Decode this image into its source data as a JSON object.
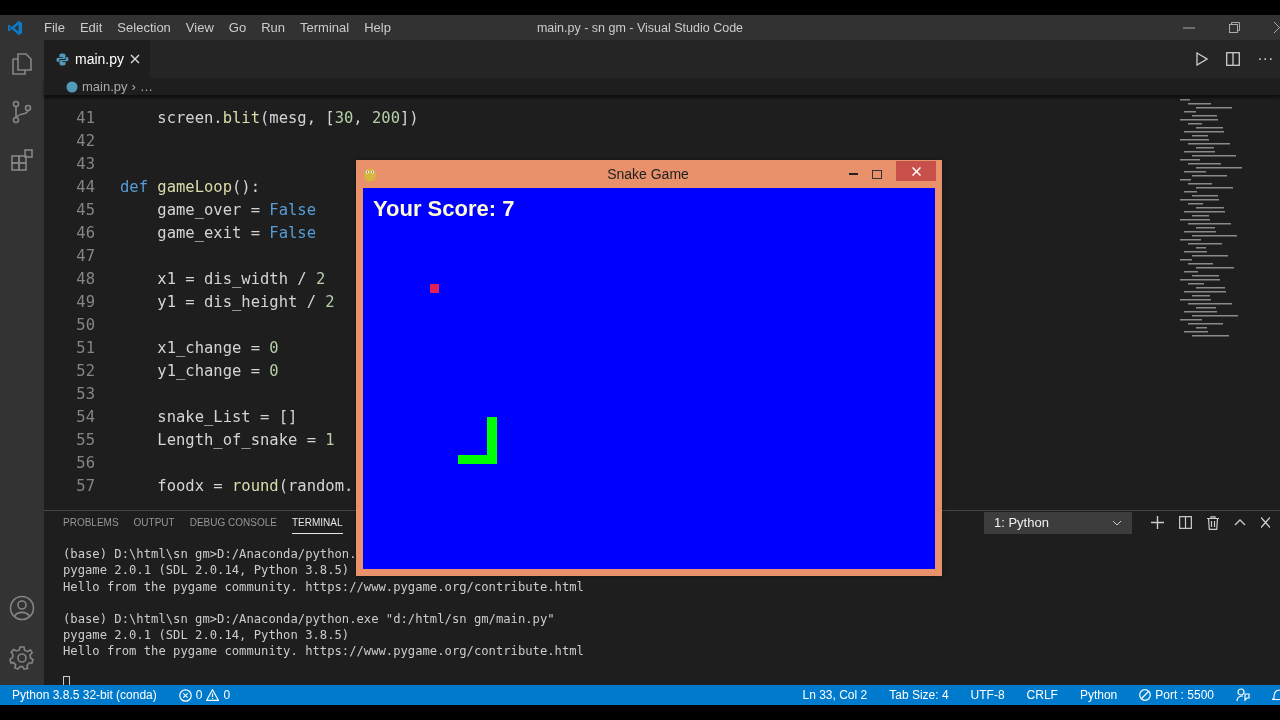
{
  "window": {
    "title": "main.py - sn gm - Visual Studio Code"
  },
  "menu": [
    "File",
    "Edit",
    "Selection",
    "View",
    "Go",
    "Run",
    "Terminal",
    "Help"
  ],
  "tabs": [
    {
      "label": "main.py",
      "selected": true
    }
  ],
  "breadcrumb": {
    "file": "main.py",
    "separator": "›",
    "more": "…"
  },
  "editor_actions": {
    "more": "···"
  },
  "code_lines": [
    {
      "number": "41",
      "tokens": [
        {
          "text": "    screen.",
          "kind": "plain"
        },
        {
          "text": "blit",
          "kind": "function"
        },
        {
          "text": "(mesg, [",
          "kind": "plain"
        },
        {
          "text": "30",
          "kind": "number"
        },
        {
          "text": ", ",
          "kind": "plain"
        },
        {
          "text": "200",
          "kind": "number"
        },
        {
          "text": "])",
          "kind": "plain"
        }
      ]
    },
    {
      "number": "42"
    },
    {
      "number": "43"
    },
    {
      "number": "44",
      "tokens": [
        {
          "text": "def ",
          "kind": "keyword"
        },
        {
          "text": "gameLoop",
          "kind": "function"
        },
        {
          "text": "():",
          "kind": "plain"
        }
      ]
    },
    {
      "number": "45",
      "tokens": [
        {
          "text": "    game_over = ",
          "kind": "plain"
        },
        {
          "text": "False",
          "kind": "keyword"
        }
      ]
    },
    {
      "number": "46",
      "tokens": [
        {
          "text": "    game_exit = ",
          "kind": "plain"
        },
        {
          "text": "False",
          "kind": "keyword"
        }
      ]
    },
    {
      "number": "47"
    },
    {
      "number": "48",
      "tokens": [
        {
          "text": "    x1 = dis_width / ",
          "kind": "plain"
        },
        {
          "text": "2",
          "kind": "number"
        }
      ]
    },
    {
      "number": "49",
      "tokens": [
        {
          "text": "    y1 = dis_height / ",
          "kind": "plain"
        },
        {
          "text": "2",
          "kind": "number"
        }
      ]
    },
    {
      "number": "50"
    },
    {
      "number": "51",
      "tokens": [
        {
          "text": "    x1_change = ",
          "kind": "plain"
        },
        {
          "text": "0",
          "kind": "number"
        }
      ]
    },
    {
      "number": "52",
      "tokens": [
        {
          "text": "    y1_change = ",
          "kind": "plain"
        },
        {
          "text": "0",
          "kind": "number"
        }
      ]
    },
    {
      "number": "53"
    },
    {
      "number": "54",
      "tokens": [
        {
          "text": "    snake_List = []",
          "kind": "plain"
        }
      ]
    },
    {
      "number": "55",
      "tokens": [
        {
          "text": "    Length_of_snake = ",
          "kind": "plain"
        },
        {
          "text": "1",
          "kind": "number"
        }
      ]
    },
    {
      "number": "56"
    },
    {
      "number": "57",
      "tokens": [
        {
          "text": "    foodx = ",
          "kind": "plain"
        },
        {
          "text": "round",
          "kind": "function"
        },
        {
          "text": "(random.",
          "kind": "plain"
        }
      ]
    }
  ],
  "panel": {
    "tabs": [
      {
        "label": "PROBLEMS",
        "selected": false
      },
      {
        "label": "OUTPUT",
        "selected": false
      },
      {
        "label": "DEBUG CONSOLE",
        "selected": false
      },
      {
        "label": "TERMINAL",
        "selected": true
      }
    ],
    "terminal_select": "1: Python",
    "terminal_runs": [
      [
        "(base) D:\\html\\sn gm>D:/Anaconda/python.",
        "pygame 2.0.1 (SDL 2.0.14, Python 3.8.5)",
        "Hello from the pygame community. https://www.pygame.org/contribute.html"
      ],
      [
        "(base) D:\\html\\sn gm>D:/Anaconda/python.exe \"d:/html/sn gm/main.py\"",
        "pygame 2.0.1 (SDL 2.0.14, Python 3.8.5)",
        "Hello from the pygame community. https://www.pygame.org/contribute.html"
      ]
    ]
  },
  "status_bar": {
    "interpreter": "Python 3.8.5 32-bit (conda)",
    "errors": "0",
    "warnings": "0",
    "right": [
      "Ln 33, Col 2",
      "Tab Size: 4",
      "UTF-8",
      "CRLF",
      "Python"
    ],
    "port": "Port : 5500"
  },
  "game_window": {
    "title": "Snake Game",
    "score": "Your Score: 7"
  }
}
